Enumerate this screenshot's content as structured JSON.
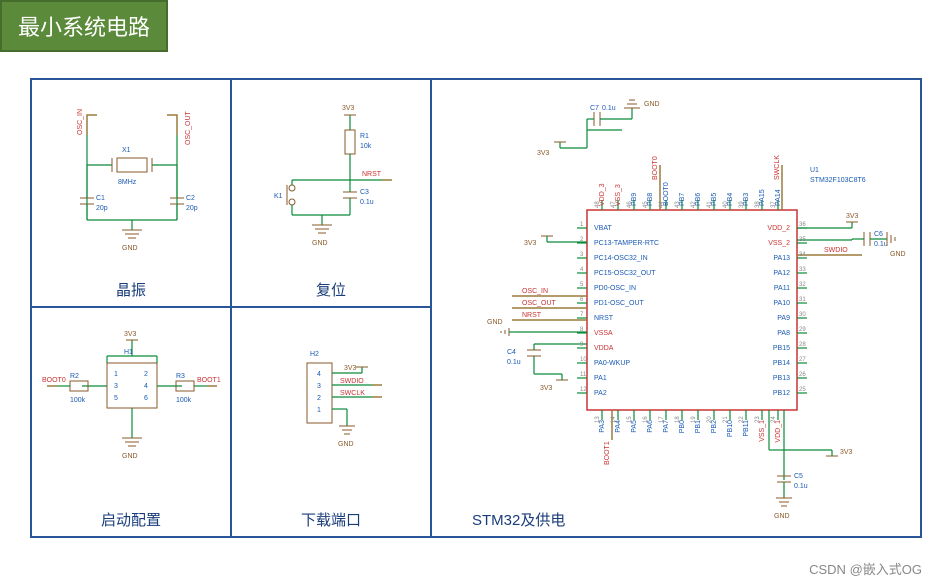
{
  "title": "最小系统电路",
  "sections": {
    "crystal": {
      "label": "晶振",
      "net_in": "OSC_IN",
      "net_out": "OSC_OUT",
      "x1": "X1",
      "freq": "8MHz",
      "c1": "C1",
      "c1v": "20p",
      "c2": "C2",
      "c2v": "20p",
      "gnd": "GND"
    },
    "reset": {
      "label": "复位",
      "v": "3V3",
      "r1": "R1",
      "r1v": "10k",
      "nrst": "NRST",
      "k1": "K1",
      "c3": "C3",
      "c3v": "0.1u",
      "gnd": "GND"
    },
    "boot": {
      "label": "启动配置",
      "v": "3V3",
      "h1": "H1",
      "r2": "R2",
      "r2v": "100k",
      "r3": "R3",
      "r3v": "100k",
      "boot0": "BOOT0",
      "boot1": "BOOT1",
      "gnd": "GND",
      "pins": [
        "1",
        "2",
        "3",
        "4",
        "5",
        "6"
      ]
    },
    "swd": {
      "label": "下载端口",
      "h2": "H2",
      "v": "3V3",
      "swdio": "SWDIO",
      "swclk": "SWCLK",
      "gnd": "GND",
      "pins": [
        "1",
        "2",
        "3",
        "4"
      ]
    },
    "mcu": {
      "label": "STM32及供电",
      "u1": "U1",
      "part": "STM32F103C8T6",
      "v": "3V3",
      "gnd": "GND",
      "c4": "C4",
      "c4v": "0.1u",
      "c5": "C5",
      "c5v": "0.1u",
      "c6": "C6",
      "c6v": "0.1u",
      "c7": "C7",
      "c7v": "0.1u",
      "nets": {
        "osc_in": "OSC_IN",
        "osc_out": "OSC_OUT",
        "nrst": "NRST",
        "boot0": "BOOT0",
        "boot1": "BOOT1",
        "swdio": "SWDIO",
        "swclk": "SWCLK"
      },
      "left_pins": [
        {
          "n": "1",
          "l": "VBAT",
          "c": "blue"
        },
        {
          "n": "2",
          "l": "PC13-TAMPER-RTC",
          "c": "blue"
        },
        {
          "n": "3",
          "l": "PC14-OSC32_IN",
          "c": "blue"
        },
        {
          "n": "4",
          "l": "PC15-OSC32_OUT",
          "c": "blue"
        },
        {
          "n": "5",
          "l": "PD0-OSC_IN",
          "c": "blue"
        },
        {
          "n": "6",
          "l": "PD1-OSC_OUT",
          "c": "blue"
        },
        {
          "n": "7",
          "l": "NRST",
          "c": "blue"
        },
        {
          "n": "8",
          "l": "VSSA",
          "c": "red"
        },
        {
          "n": "9",
          "l": "VDDA",
          "c": "red"
        },
        {
          "n": "10",
          "l": "PA0-WKUP",
          "c": "blue"
        },
        {
          "n": "11",
          "l": "PA1",
          "c": "blue"
        },
        {
          "n": "12",
          "l": "PA2",
          "c": "blue"
        }
      ],
      "right_pins": [
        {
          "n": "36",
          "l": "VDD_2",
          "c": "red"
        },
        {
          "n": "35",
          "l": "VSS_2",
          "c": "red"
        },
        {
          "n": "34",
          "l": "PA13",
          "c": "blue"
        },
        {
          "n": "33",
          "l": "PA12",
          "c": "blue"
        },
        {
          "n": "32",
          "l": "PA11",
          "c": "blue"
        },
        {
          "n": "31",
          "l": "PA10",
          "c": "blue"
        },
        {
          "n": "30",
          "l": "PA9",
          "c": "blue"
        },
        {
          "n": "29",
          "l": "PA8",
          "c": "blue"
        },
        {
          "n": "28",
          "l": "PB15",
          "c": "blue"
        },
        {
          "n": "27",
          "l": "PB14",
          "c": "blue"
        },
        {
          "n": "26",
          "l": "PB13",
          "c": "blue"
        },
        {
          "n": "25",
          "l": "PB12",
          "c": "blue"
        }
      ],
      "top_pins": [
        {
          "n": "48",
          "l": "VDD_3",
          "c": "red"
        },
        {
          "n": "47",
          "l": "VSS_3",
          "c": "red"
        },
        {
          "n": "46",
          "l": "PB9",
          "c": "blue"
        },
        {
          "n": "45",
          "l": "PB8",
          "c": "blue"
        },
        {
          "n": "44",
          "l": "BOOT0",
          "c": "blue"
        },
        {
          "n": "43",
          "l": "PB7",
          "c": "blue"
        },
        {
          "n": "42",
          "l": "PB6",
          "c": "blue"
        },
        {
          "n": "41",
          "l": "PB5",
          "c": "blue"
        },
        {
          "n": "40",
          "l": "PB4",
          "c": "blue"
        },
        {
          "n": "39",
          "l": "PB3",
          "c": "blue"
        },
        {
          "n": "38",
          "l": "PA15",
          "c": "blue"
        },
        {
          "n": "37",
          "l": "PA14",
          "c": "blue"
        }
      ],
      "bottom_pins": [
        {
          "n": "13",
          "l": "PA3",
          "c": "blue"
        },
        {
          "n": "14",
          "l": "PA4",
          "c": "blue"
        },
        {
          "n": "15",
          "l": "PA5",
          "c": "blue"
        },
        {
          "n": "16",
          "l": "PA6",
          "c": "blue"
        },
        {
          "n": "17",
          "l": "PA7",
          "c": "blue"
        },
        {
          "n": "18",
          "l": "PB0",
          "c": "blue"
        },
        {
          "n": "19",
          "l": "PB1",
          "c": "blue"
        },
        {
          "n": "20",
          "l": "PB2",
          "c": "blue"
        },
        {
          "n": "21",
          "l": "PB10",
          "c": "blue"
        },
        {
          "n": "22",
          "l": "PB11",
          "c": "blue"
        },
        {
          "n": "23",
          "l": "VSS_1",
          "c": "red"
        },
        {
          "n": "24",
          "l": "VDD_1",
          "c": "red"
        }
      ]
    }
  },
  "footer": {
    "site": "CSDN",
    "author": "@嵌入式OG"
  }
}
